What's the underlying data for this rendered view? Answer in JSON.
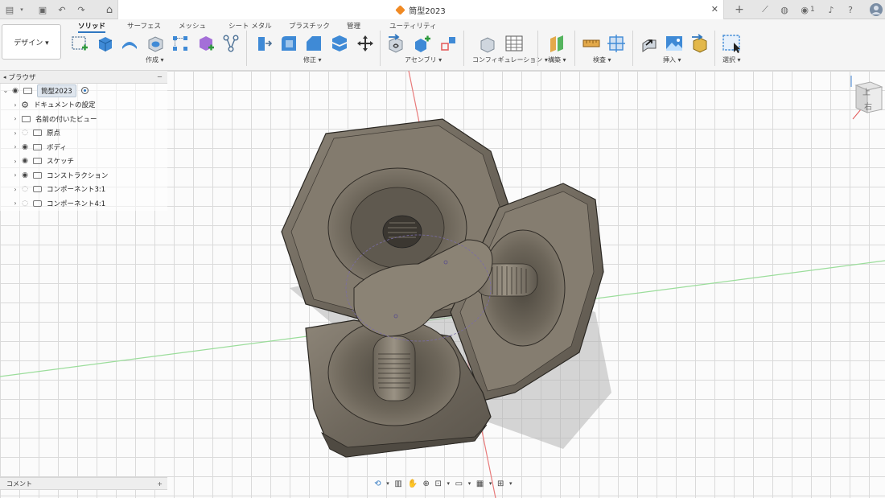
{
  "topbar": {
    "doc_title": "筒型2023",
    "notifications_count": "1"
  },
  "ribbon": {
    "workspace_label": "デザイン ▾",
    "tabs": [
      "ソリッド",
      "サーフェス",
      "メッシュ",
      "シート メタル",
      "プラスチック",
      "管理",
      "ユーティリティ"
    ],
    "groups": {
      "create": "作成 ▾",
      "modify": "修正 ▾",
      "assemble": "アセンブリ ▾",
      "configure": "コンフィギュレーション ▾",
      "construct": "構築 ▾",
      "inspect": "検査 ▾",
      "insert": "挿入 ▾",
      "select": "選択 ▾"
    }
  },
  "browser": {
    "title": "ブラウザ",
    "root": "筒型2023",
    "items": [
      {
        "label": "ドキュメントの設定",
        "icon": "gear-icon"
      },
      {
        "label": "名前の付いたビュー",
        "icon": "folder-icon"
      },
      {
        "label": "原点",
        "icon": "folder-icon"
      },
      {
        "label": "ボディ",
        "icon": "folder-icon"
      },
      {
        "label": "スケッチ",
        "icon": "folder-icon"
      },
      {
        "label": "コンストラクション",
        "icon": "folder-icon"
      },
      {
        "label": "コンポーネント3:1",
        "icon": "component-icon"
      },
      {
        "label": "コンポーネント4:1",
        "icon": "component-icon"
      }
    ]
  },
  "comments": {
    "title": "コメント"
  },
  "viewcube": {
    "top_face": "上",
    "right_face": "右"
  },
  "colors": {
    "accent": "#2f77c0",
    "body_metal": "#7a7266",
    "grid": "#dadada",
    "axis_red": "#e25b5b",
    "axis_green": "#8fd88f"
  }
}
